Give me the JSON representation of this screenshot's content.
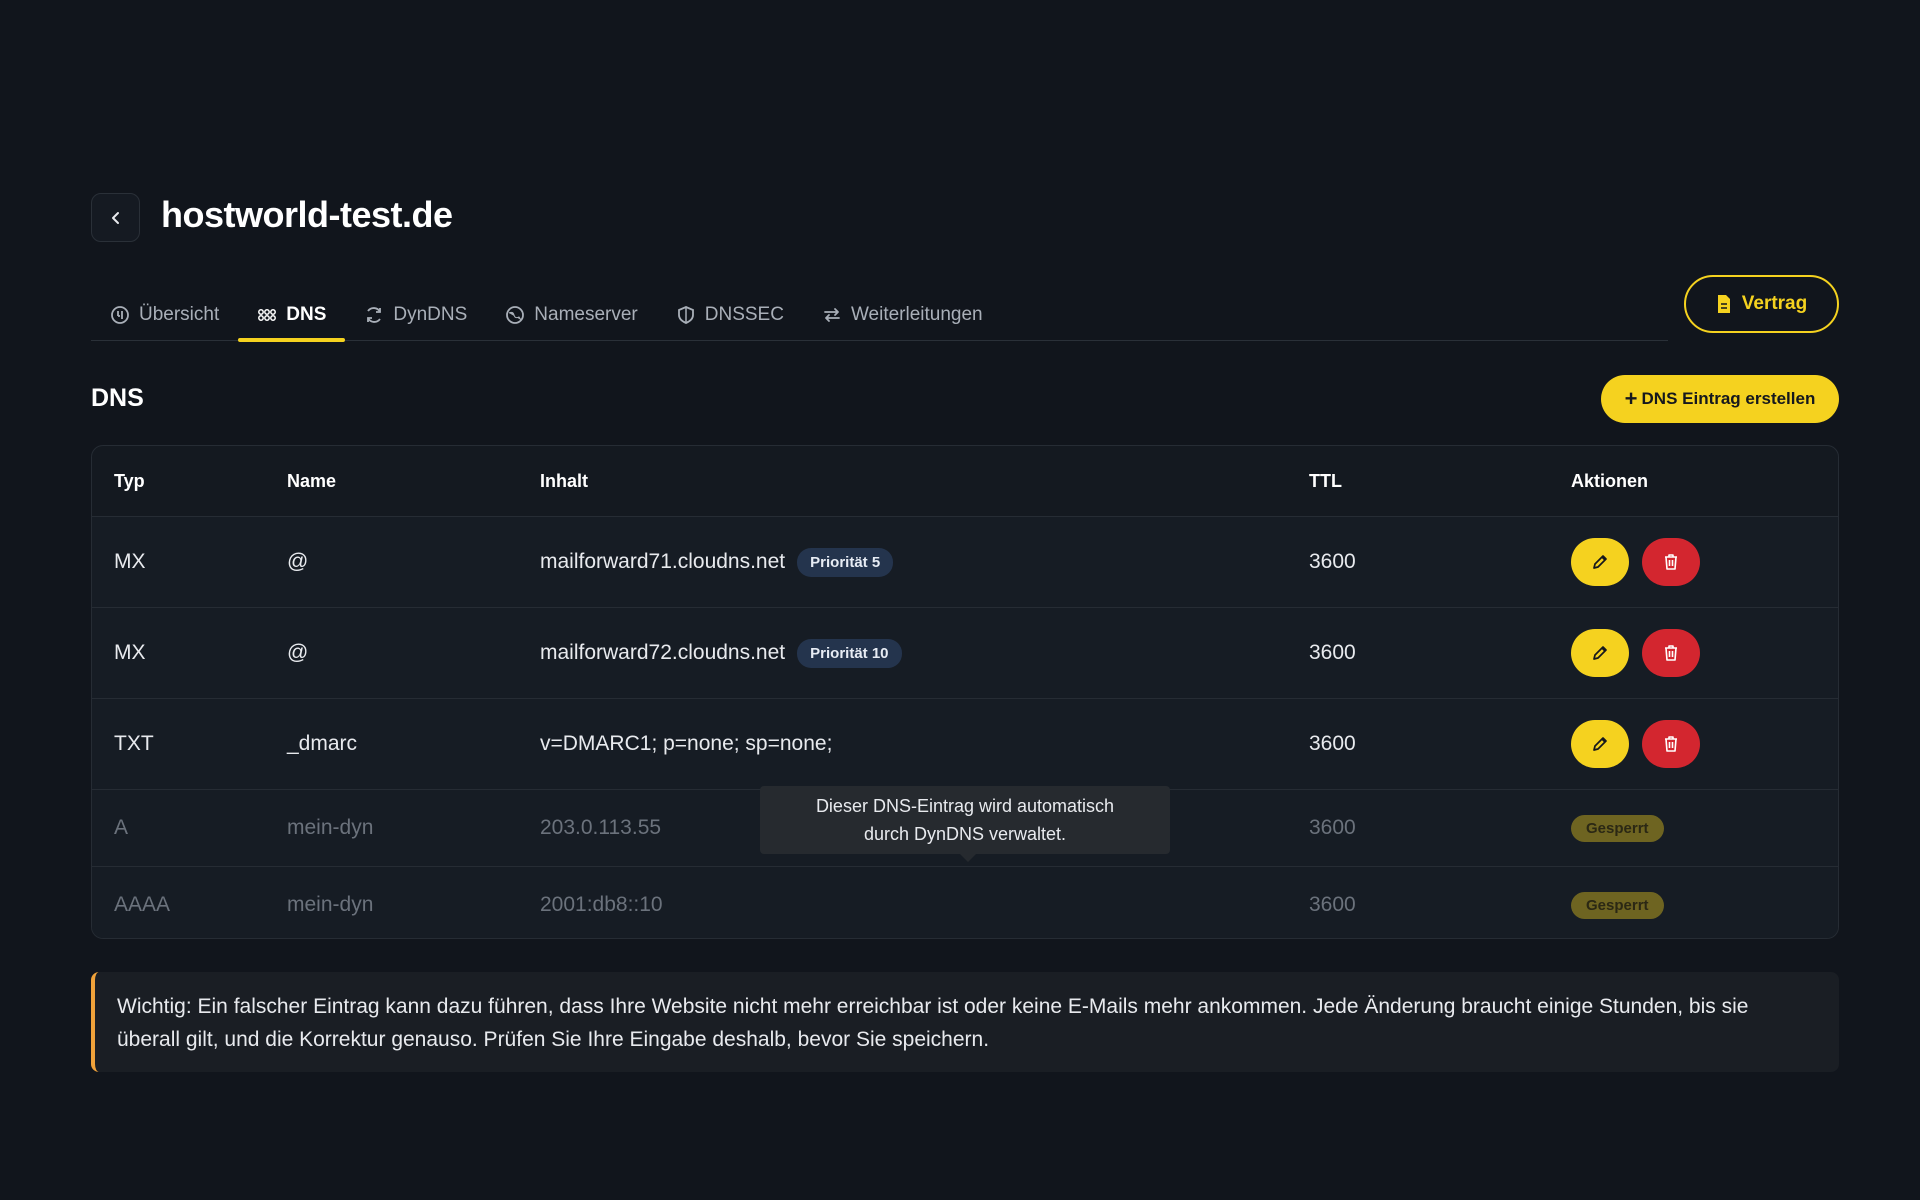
{
  "header": {
    "title": "hostworld-test.de"
  },
  "tabs": [
    {
      "label": "Übersicht",
      "icon": "overview-icon",
      "active": false
    },
    {
      "label": "DNS",
      "icon": "grid-icon",
      "active": true
    },
    {
      "label": "DynDNS",
      "icon": "refresh-icon",
      "active": false
    },
    {
      "label": "Nameserver",
      "icon": "globe-icon",
      "active": false
    },
    {
      "label": "DNSSEC",
      "icon": "shield-icon",
      "active": false
    },
    {
      "label": "Weiterleitungen",
      "icon": "swap-arrows-icon",
      "active": false
    }
  ],
  "contract_button": {
    "label": "Vertrag",
    "icon": "document-icon"
  },
  "section": {
    "title": "DNS",
    "create_button": "DNS Eintrag erstellen"
  },
  "table": {
    "columns": {
      "typ": "Typ",
      "name": "Name",
      "inhalt": "Inhalt",
      "ttl": "TTL",
      "aktionen": "Aktionen"
    },
    "rows": [
      {
        "typ": "MX",
        "name": "@",
        "inhalt": "mailforward71.cloudns.net",
        "badge": "Priorität 5",
        "ttl": "3600"
      },
      {
        "typ": "MX",
        "name": "@",
        "inhalt": "mailforward72.cloudns.net",
        "badge": "Priorität 10",
        "ttl": "3600"
      },
      {
        "typ": "TXT",
        "name": "_dmarc",
        "inhalt": "v=DMARC1; p=none; sp=none;",
        "ttl": "3600"
      },
      {
        "typ": "A",
        "name": "mein-dyn",
        "inhalt": "203.0.113.55",
        "ttl": "3600",
        "status": "Gesperrt"
      },
      {
        "typ": "AAAA",
        "name": "mein-dyn",
        "inhalt": "2001:db8::10",
        "ttl": "3600",
        "status": "Gesperrt"
      }
    ]
  },
  "tooltip": {
    "line1": "Dieser DNS-Eintrag wird automatisch",
    "line2": "durch DynDNS verwaltet."
  },
  "warning": {
    "text": "Wichtig: Ein falscher Eintrag kann dazu führen, dass Ihre Website nicht mehr erreichbar ist oder keine E-Mails mehr ankommen. Jede Änderung braucht einige Stunden, bis sie überall gilt, und die Korrektur genauso. Prüfen Sie Ihre Eingabe deshalb, bevor Sie speichern."
  },
  "colors": {
    "accent": "#f5d21f",
    "danger": "#d3262f",
    "warning_border": "#f0a23a",
    "background": "#11151c"
  }
}
